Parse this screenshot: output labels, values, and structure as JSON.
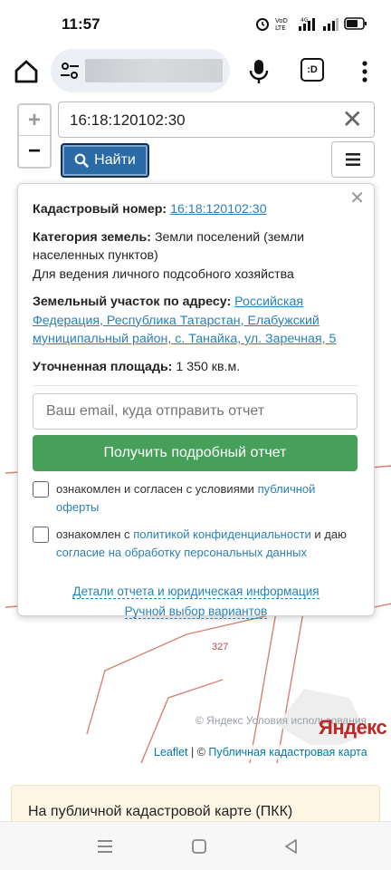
{
  "status_bar": {
    "time": "11:57",
    "icons": [
      "alarm-icon",
      "volte-icon",
      "4g-signal-icon",
      "signal-icon",
      "battery-icon"
    ]
  },
  "browser": {
    "home_icon": "home-icon",
    "tab_count_label": ":D",
    "icons": [
      "tune-icon",
      "mic-icon",
      "menu-dots-icon"
    ]
  },
  "map": {
    "parcel_label": "327",
    "yandex_logo": "Яндекс",
    "yandex_terms": "© Яндекс  Условия использования",
    "attribution_leaflet": "Leaflet",
    "attribution_separator": " | © ",
    "attribution_source": "Публичная кадастровая карта",
    "zoom_in": "+",
    "zoom_out": "−"
  },
  "search": {
    "value": "16:18:120102:30",
    "clear": "✕",
    "find_label": "Найти"
  },
  "popup": {
    "cadastral_label": "Кадастровый номер:",
    "cadastral_value": "16:18:120102:30",
    "category_label": "Категория земель:",
    "category_value": "Земли поселений (земли населенных пунктов)",
    "usage": "Для ведения личного подсобного хозяйства",
    "address_label": "Земельный участок по адресу:",
    "address_value": "Российская Федерация, Республика Татарстан, Елабужский муниципальный район, с. Танайка, ул. Заречная, 5",
    "area_label": "Уточненная площадь:",
    "area_value": "1 350 кв.м.",
    "email_placeholder": "Ваш email, куда отправить отчет",
    "report_button": "Получить подробный отчет",
    "consent1_text": "ознакомлен и согласен с условиями ",
    "consent1_link": "публичной оферты",
    "consent2_text": "ознакомлен с ",
    "consent2_link": "политикой конфиденциальности",
    "consent2_mid": " и даю ",
    "consent2_link2": "согласие на обработку персональных данных",
    "details_link": "Детали отчета и юридическая информация",
    "manual_link": "Ручной выбор вариантов",
    "close": "✕"
  },
  "info_card": {
    "text": "На публичной кадастровой карте (ПКК)"
  },
  "nav_bar": {
    "icons": [
      "recents-icon",
      "home-square-icon",
      "back-triangle-icon"
    ]
  }
}
